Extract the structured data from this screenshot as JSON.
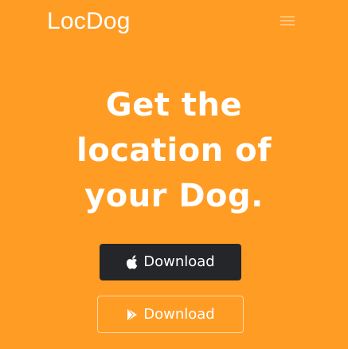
{
  "navbar": {
    "brand": "LocDog",
    "menu_icon": "hamburger-menu-icon"
  },
  "hero": {
    "title_lines": [
      "Get the",
      "location of",
      "your Dog."
    ]
  },
  "buttons": {
    "app_store": {
      "label": "Download",
      "icon": "apple-icon"
    },
    "play_store": {
      "label": "Download",
      "icon": "play-icon"
    }
  },
  "colors": {
    "background": "#ff9c24",
    "dark_button": "#242629",
    "text": "#ffffff"
  }
}
